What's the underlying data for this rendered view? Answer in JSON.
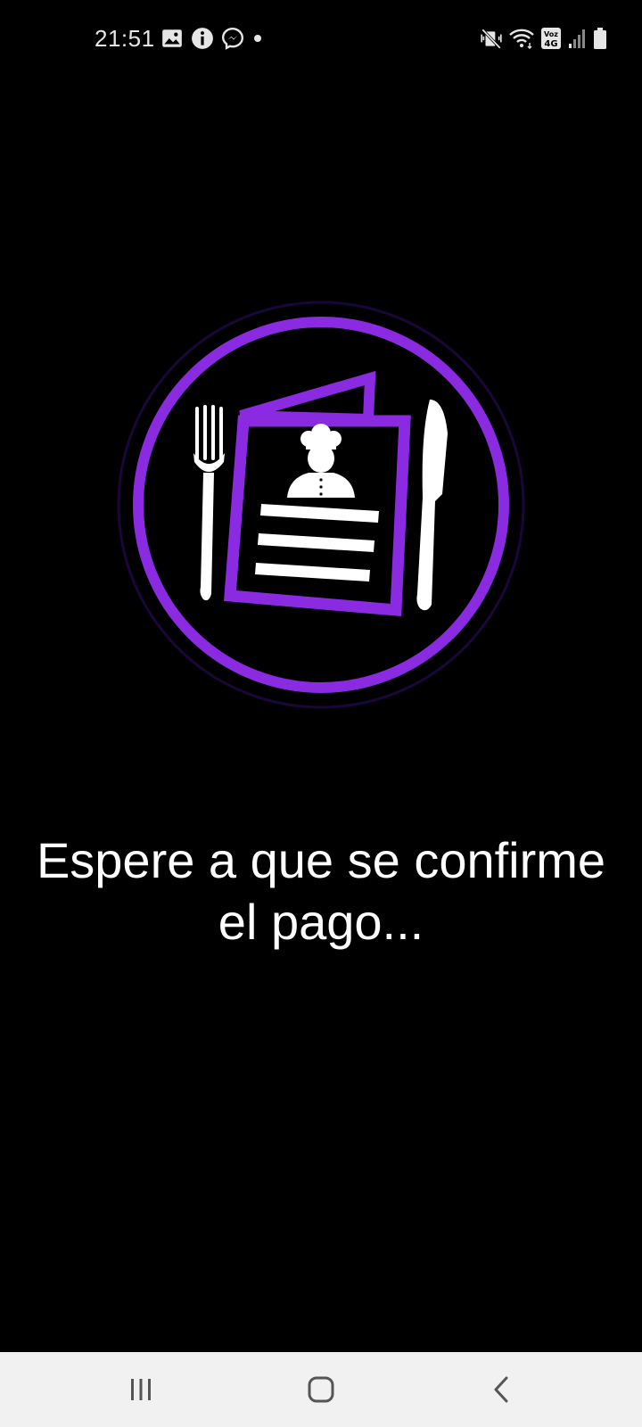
{
  "status_bar": {
    "time": "21:51",
    "notification_icons": [
      "image-icon",
      "info-icon",
      "messenger-icon",
      "dot-icon"
    ],
    "system_icons": [
      "vibrate-mute-icon",
      "wifi-icon",
      "volte-4g-icon",
      "signal-icon",
      "battery-icon"
    ],
    "volte_label_top": "Voz",
    "volte_label_bottom": "4G"
  },
  "logo": {
    "icon": "restaurant-menu-logo-icon",
    "accent_color": "#8a2be2"
  },
  "message": {
    "line1": "Espere a que se confirme",
    "line2": "el pago..."
  },
  "nav_bar": {
    "buttons": [
      "recent-apps-icon",
      "home-icon",
      "back-icon"
    ]
  }
}
